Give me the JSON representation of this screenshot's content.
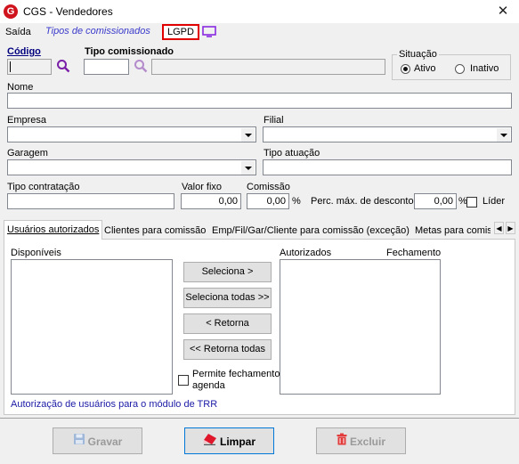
{
  "window": {
    "title": "CGS - Vendedores",
    "close_glyph": "✕",
    "app_icon_letter": "G"
  },
  "menu": {
    "saida": "Saída",
    "tipos_comissionados": "Tipos de comissionados",
    "lgpd": "LGPD",
    "highlight_color": "#e00000"
  },
  "form": {
    "codigo_label": "Código",
    "tipo_comissionado_label": "Tipo comissionado",
    "situacao_label": "Situação",
    "ativo_label": "Ativo",
    "inativo_label": "Inativo",
    "situacao_selected": "Ativo",
    "nome_label": "Nome",
    "empresa_label": "Empresa",
    "filial_label": "Filial",
    "garagem_label": "Garagem",
    "tipo_atuacao_label": "Tipo atuação",
    "tipo_contratacao_label": "Tipo contratação",
    "valor_fixo_label": "Valor fixo",
    "valor_fixo_value": "0,00",
    "comissao_label": "Comissão",
    "comissao_value": "0,00",
    "percent_sign": "%",
    "perc_max_label": "Perc. máx. de desconto",
    "perc_max_value": "0,00",
    "perc_max_sign": "%",
    "lider_label": "Líder"
  },
  "tabs": [
    {
      "label": "Usuários autorizados",
      "active": true
    },
    {
      "label": "Clientes para comissão",
      "active": false
    },
    {
      "label": "Emp/Fil/Gar/Cliente para comissão (exceção)",
      "active": false
    },
    {
      "label": "Metas para comiss",
      "active": false
    }
  ],
  "tab_scroll": {
    "left": "◀",
    "right": "▶"
  },
  "panel": {
    "disponiveis_label": "Disponíveis",
    "autorizados_label": "Autorizados",
    "fechamento_label": "Fechamento",
    "seleciona": "Seleciona >",
    "seleciona_todas": "Seleciona todas >>",
    "retorna": "< Retorna",
    "retorna_todas": "<< Retorna todas",
    "permite_fechamento": "Permite fechamento",
    "agenda": "agenda",
    "footer_note": "Autorização de usuários para o módulo de TRR",
    "note_color": "#1a1aa6"
  },
  "footer": {
    "gravar": "Gravar",
    "limpar": "Limpar",
    "excluir": "Excluir"
  },
  "icons": {
    "search": "search-icon",
    "monitor": "monitor-icon",
    "save": "floppy-disk-icon",
    "eraser": "eraser-icon",
    "trash": "trash-icon"
  }
}
